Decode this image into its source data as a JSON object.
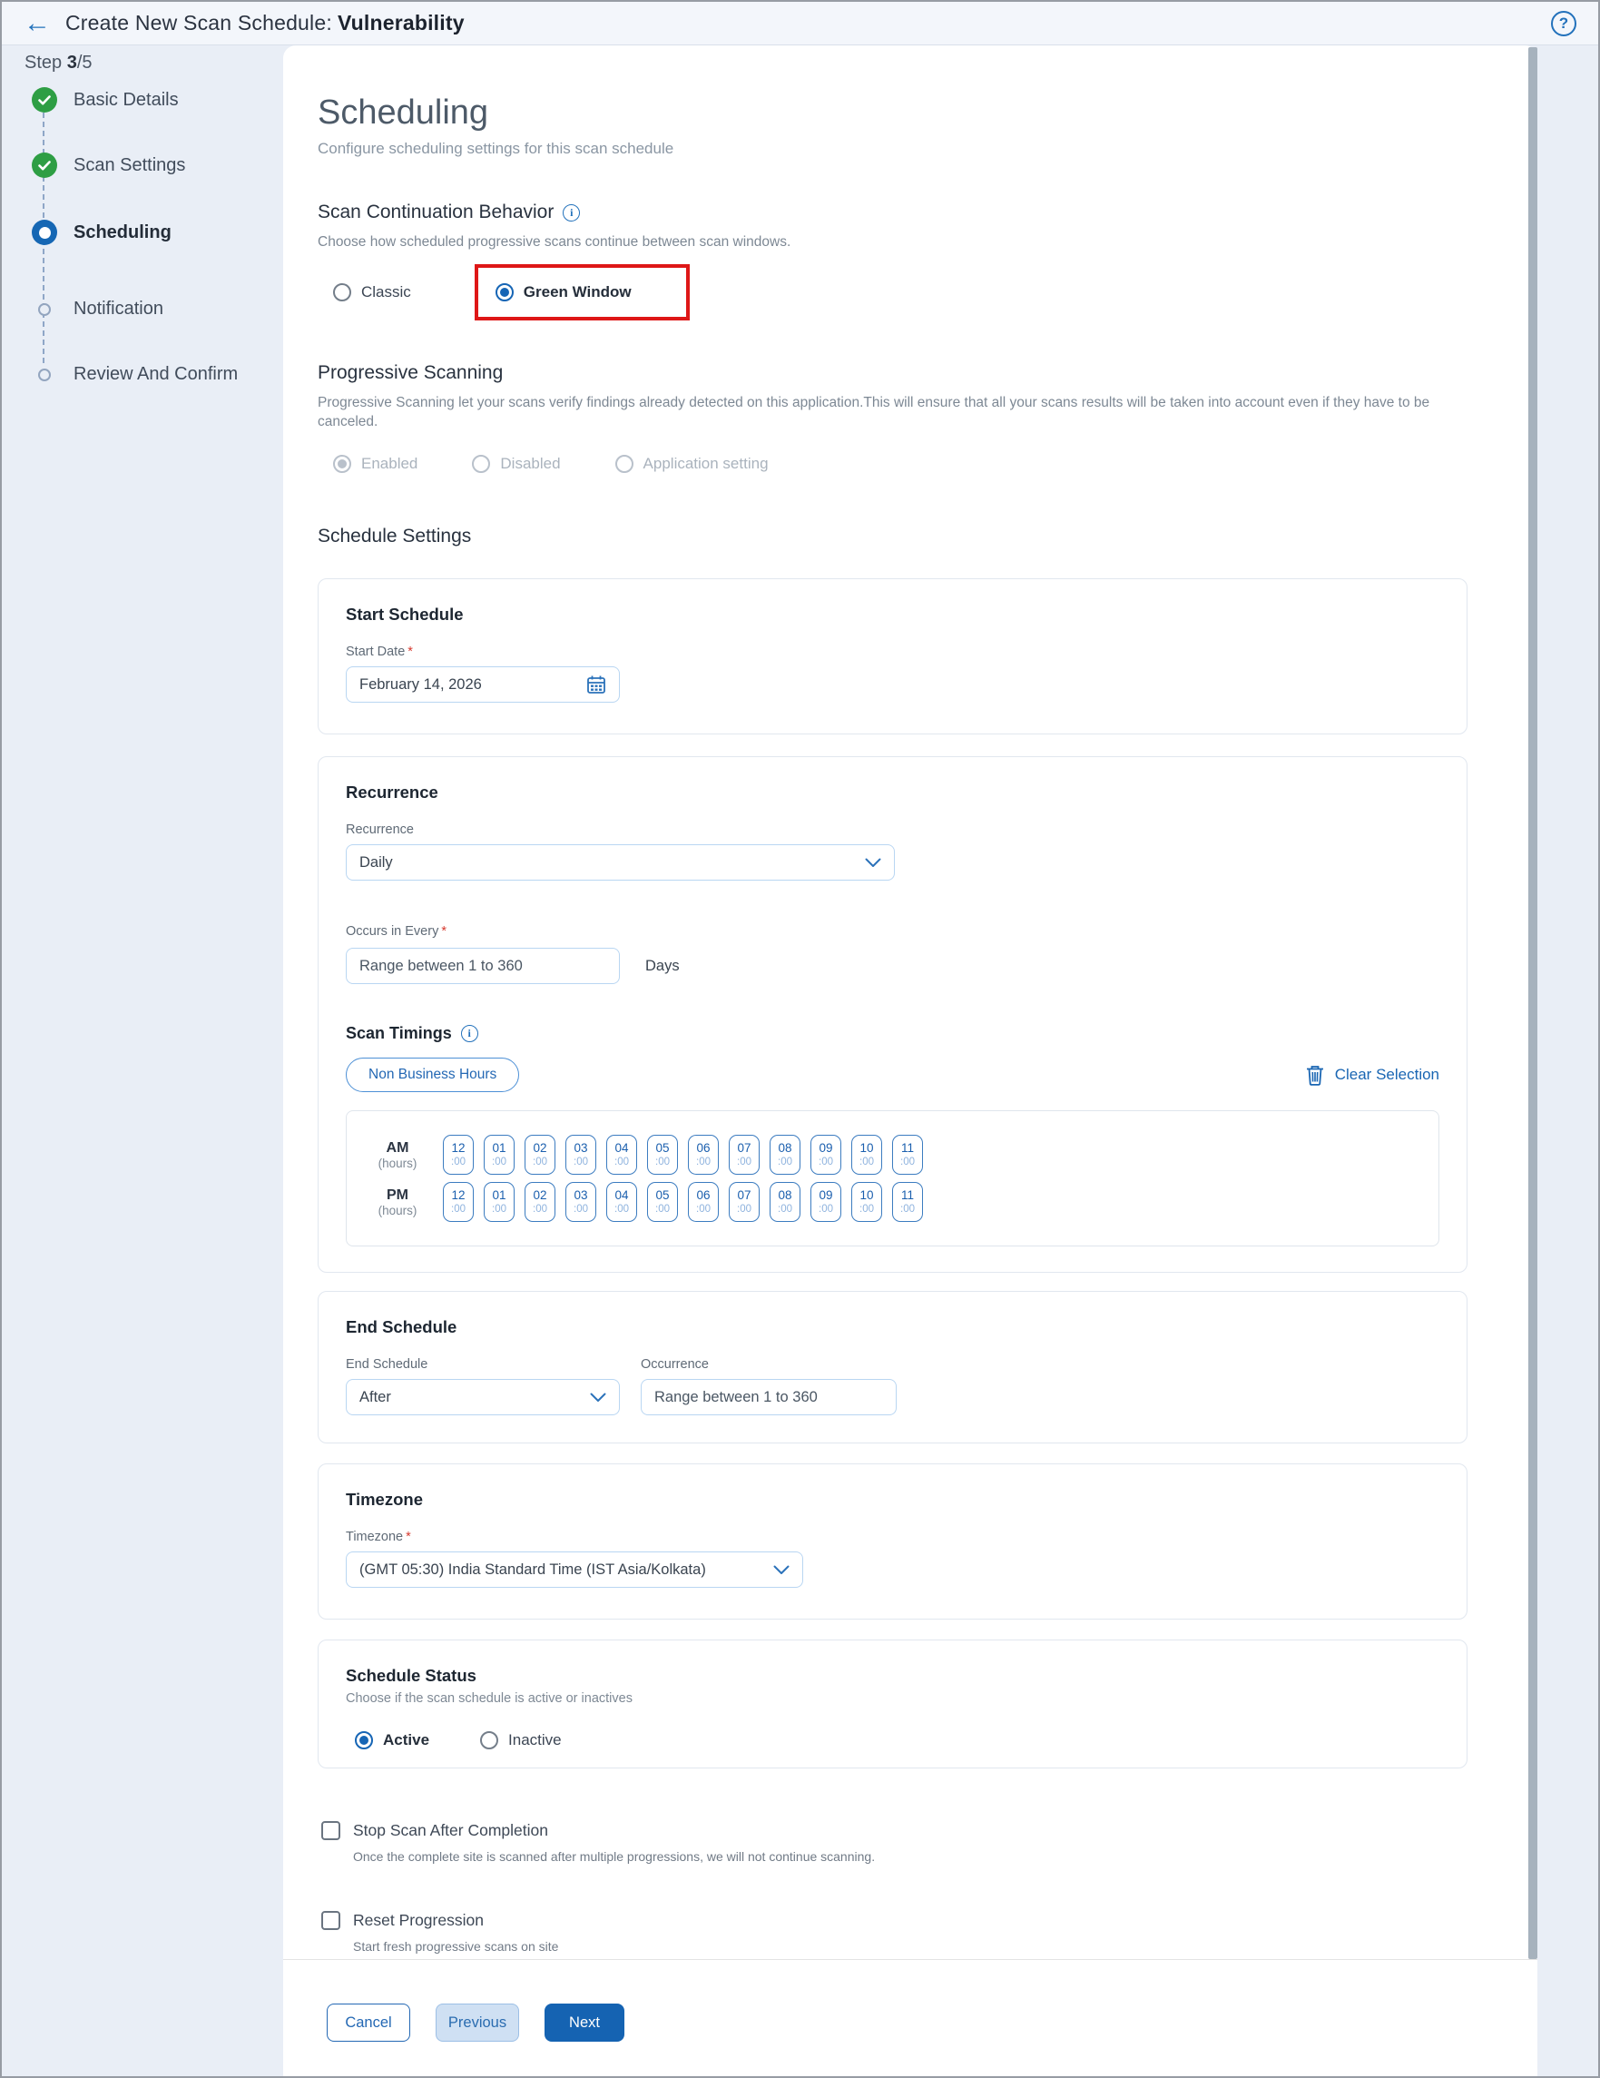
{
  "ui": {
    "required_mark": "*"
  },
  "header": {
    "title_prefix": "Create New Scan Schedule:",
    "title_bold": "Vulnerability"
  },
  "stepper": {
    "step_prefix": "Step ",
    "step_current": "3",
    "step_rest": "/5",
    "items": [
      {
        "label": "Basic Details",
        "state": "complete"
      },
      {
        "label": "Scan Settings",
        "state": "complete"
      },
      {
        "label": "Scheduling",
        "state": "active"
      },
      {
        "label": "Notification",
        "state": "pending"
      },
      {
        "label": "Review And Confirm",
        "state": "pending"
      }
    ]
  },
  "page": {
    "title": "Scheduling",
    "subtitle": "Configure scheduling settings for this scan schedule"
  },
  "scan_continuation": {
    "title": "Scan Continuation Behavior",
    "description": "Choose how scheduled progressive scans continue between scan windows.",
    "options": [
      {
        "label": "Classic",
        "selected": false
      },
      {
        "label": "Green Window",
        "selected": true,
        "highlighted": true
      }
    ]
  },
  "progressive_scanning": {
    "title": "Progressive Scanning",
    "description": "Progressive Scanning let your scans verify findings already detected on this application.This will ensure that all your scans results will be taken into account even if they have to be canceled.",
    "options": [
      {
        "label": "Enabled",
        "selected": true,
        "disabled": true
      },
      {
        "label": "Disabled",
        "selected": false,
        "disabled": true
      },
      {
        "label": "Application setting",
        "selected": false,
        "disabled": true
      }
    ]
  },
  "schedule_settings": {
    "title": "Schedule Settings",
    "start_schedule": {
      "title": "Start Schedule",
      "start_date_label": "Start Date",
      "start_date_value": "February 14, 2026"
    },
    "recurrence": {
      "title": "Recurrence",
      "recurrence_label": "Recurrence",
      "recurrence_value": "Daily",
      "occurs_label": "Occurs in Every",
      "occurs_placeholder": "Range between 1 to 360",
      "occurs_unit": "Days"
    },
    "scan_timings": {
      "title": "Scan Timings",
      "preset_button": "Non Business Hours",
      "clear_button": "Clear Selection",
      "am_label": "AM",
      "pm_label": "PM",
      "hours_suffix": "(hours)",
      "minute_suffix": ":00",
      "hours": [
        "12",
        "01",
        "02",
        "03",
        "04",
        "05",
        "06",
        "07",
        "08",
        "09",
        "10",
        "11"
      ]
    },
    "end_schedule": {
      "title": "End Schedule",
      "end_label": "End Schedule",
      "end_value": "After",
      "occurrence_label": "Occurrence",
      "occurrence_placeholder": "Range between 1 to 360"
    },
    "timezone": {
      "title": "Timezone",
      "label": "Timezone",
      "value": "(GMT 05:30) India Standard Time (IST Asia/Kolkata)"
    },
    "schedule_status": {
      "title": "Schedule Status",
      "description": "Choose if the scan schedule is active or inactives",
      "options": [
        {
          "label": "Active",
          "selected": true
        },
        {
          "label": "Inactive",
          "selected": false
        }
      ]
    }
  },
  "checkboxes": [
    {
      "label": "Stop Scan After Completion",
      "description": "Once the complete site is scanned after multiple progressions, we will not continue scanning.",
      "checked": false
    },
    {
      "label": "Reset Progression",
      "description": "Start fresh progressive scans on site",
      "checked": false
    }
  ],
  "footer": {
    "cancel": "Cancel",
    "previous": "Previous",
    "next": "Next"
  },
  "colors": {
    "accent_blue": "#1a66b3",
    "success_green": "#2e9e44",
    "highlight_red": "#de1717"
  }
}
